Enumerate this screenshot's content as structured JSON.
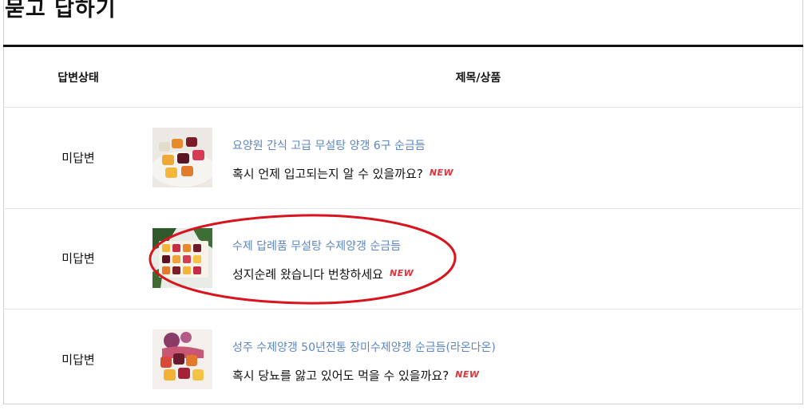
{
  "page": {
    "title": "묻고 답하기"
  },
  "table": {
    "headers": {
      "status": "답변상태",
      "subject": "제목/상품"
    },
    "rows": [
      {
        "status": "미답변",
        "product": "요양원 간식 고급 무설탕 양갱 6구 순금듬",
        "question": "혹시 언제 입고되는지 알 수 있을까요?",
        "badge": "NEW"
      },
      {
        "status": "미답변",
        "product": "수제 답례품 무설탕 수제양갱 순금듬",
        "question": "성지순례 왔습니다 번창하세요",
        "badge": "NEW"
      },
      {
        "status": "미답변",
        "product": "성주 수제양갱 50년전통 장미수제양갱 순금듬(라온다온)",
        "question": "혹시 당뇨를 앓고 있어도 먹을 수 있을까요?",
        "badge": "NEW"
      }
    ]
  },
  "colors": {
    "link": "#5b86c7",
    "badge": "#e0323a",
    "annotation": "#d9141e"
  }
}
